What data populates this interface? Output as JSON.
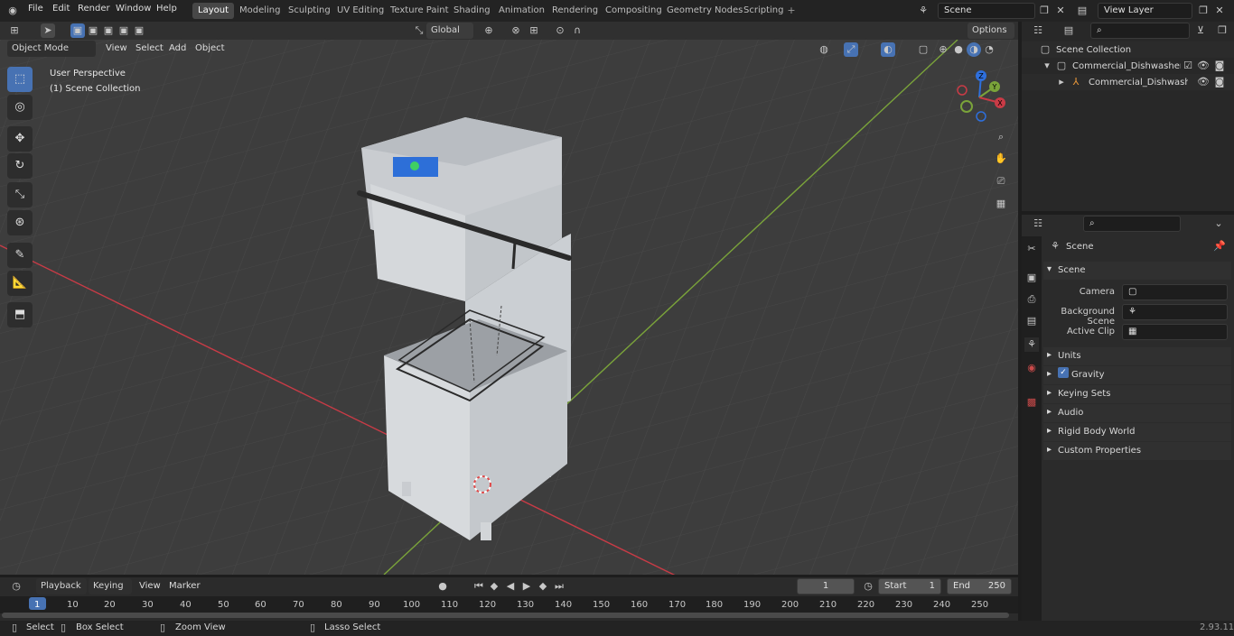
{
  "menu": [
    "File",
    "Edit",
    "Render",
    "Window",
    "Help"
  ],
  "workspaces": [
    "Layout",
    "Modeling",
    "Sculpting",
    "UV Editing",
    "Texture Paint",
    "Shading",
    "Animation",
    "Rendering",
    "Compositing",
    "Geometry Nodes",
    "Scripting"
  ],
  "scene_field": "Scene",
  "view_layer_field": "View Layer",
  "viewport": {
    "mode": "Object Mode",
    "menus": [
      "View",
      "Select",
      "Add",
      "Object"
    ],
    "transform_orientation": "Global",
    "options": "Options",
    "overlay_title": "User Perspective",
    "overlay_collection": "(1) Scene Collection",
    "gizmo_axes": [
      "Z",
      "Y",
      "X"
    ]
  },
  "outliner": {
    "collection": "Scene Collection",
    "item1": "Commercial_Dishwasher_Hoc",
    "item2": "Commercial_Dishwasher_"
  },
  "properties": {
    "header": "Scene",
    "section": "Scene",
    "camera_label": "Camera",
    "bg_label": "Background Scene",
    "clip_label": "Active Clip",
    "panels": [
      "Units",
      "Gravity",
      "Keying Sets",
      "Audio",
      "Rigid Body World",
      "Custom Properties"
    ]
  },
  "timeline": {
    "menus": [
      "Playback",
      "Keying",
      "View",
      "Marker"
    ],
    "current_frame": "1",
    "start_label": "Start",
    "start": "1",
    "end_label": "End",
    "end": "250",
    "ticks": [
      "1",
      "10",
      "20",
      "30",
      "40",
      "50",
      "60",
      "70",
      "80",
      "90",
      "100",
      "110",
      "120",
      "130",
      "140",
      "150",
      "160",
      "170",
      "180",
      "190",
      "200",
      "210",
      "220",
      "230",
      "240",
      "250"
    ]
  },
  "status": {
    "select": "Select",
    "box_select": "Box Select",
    "zoom_view": "Zoom View",
    "lasso_select": "Lasso Select",
    "version": "2.93.11"
  },
  "colors": {
    "accent": "#4772b3",
    "x_axis": "#c93b46",
    "y_axis": "#7aa33a",
    "background": "#3d3d3d"
  }
}
